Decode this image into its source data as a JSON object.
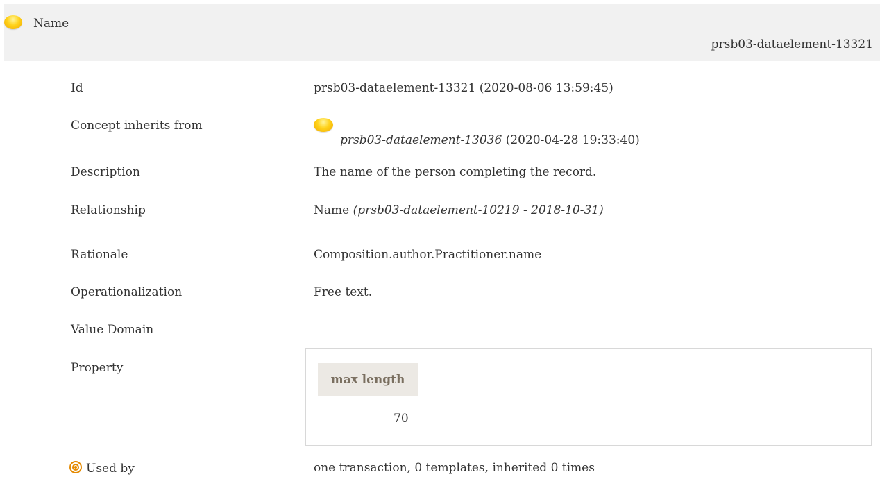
{
  "header": {
    "title": "Name",
    "id": "prsb03-dataelement-13321"
  },
  "rows": {
    "id": {
      "label": "Id",
      "value": "prsb03-dataelement-13321 (2020-08-06 13:59:45)"
    },
    "inherits": {
      "label": "Concept inherits from",
      "ref": "prsb03-dataelement-13036",
      "date": " (2020-04-28 19:33:40)"
    },
    "description": {
      "label": "Description",
      "value": "The name of the person completing the record."
    },
    "relationship": {
      "label": "Relationship",
      "name": "Name",
      "ref": "(prsb03-dataelement-10219 - 2018-10-31)"
    },
    "rationale": {
      "label": "Rationale",
      "value": "Composition.author.Practitioner.name"
    },
    "operationalization": {
      "label": "Operationalization",
      "value": "Free text."
    },
    "value_domain": {
      "label": "Value Domain"
    },
    "property": {
      "label": "Property",
      "column": "max length",
      "value": "70"
    },
    "used_by": {
      "label": "Used by",
      "value": "one transaction, 0 templates, inherited 0 times"
    }
  },
  "icons": {
    "concept_status": "yellow-circle-icon",
    "used_by": "target-icon"
  },
  "colors": {
    "header_bg": "#f1f1f1",
    "status_yellow": "#ffd21a",
    "used_by_orange": "#e58a00",
    "property_header_bg": "#ece9e4"
  }
}
